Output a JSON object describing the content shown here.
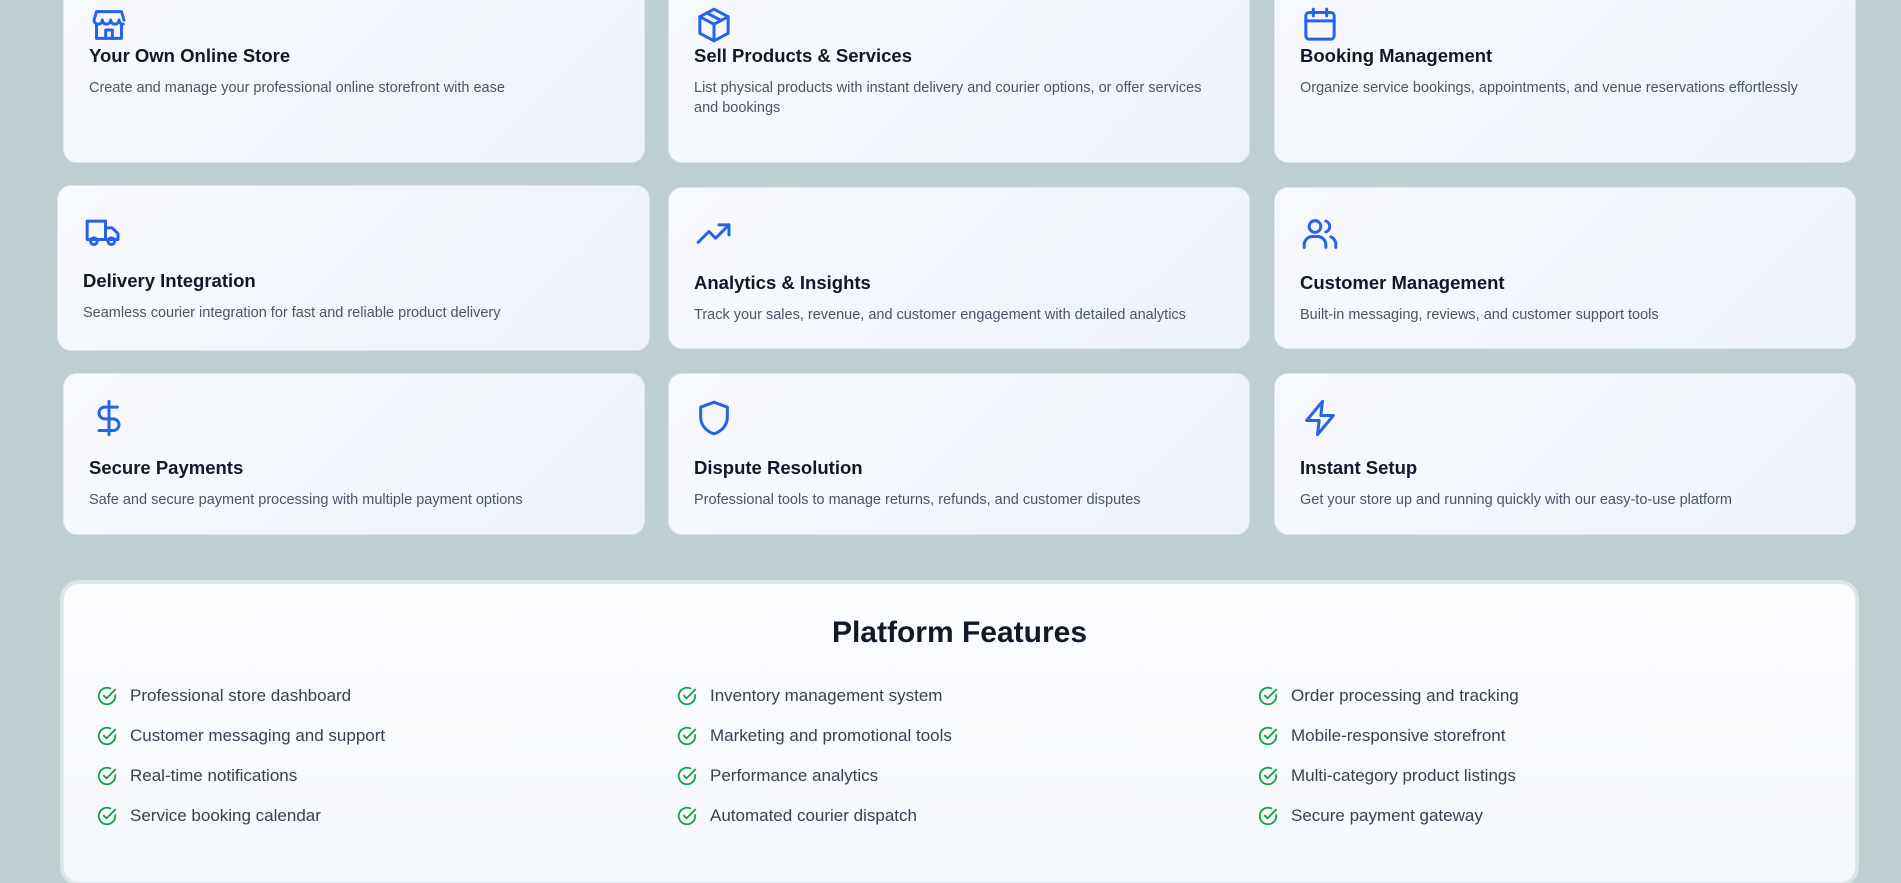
{
  "cards": [
    {
      "title": "Your Own Online Store",
      "desc": "Create and manage your professional online storefront with ease",
      "icon": "store-icon"
    },
    {
      "title": "Sell Products & Services",
      "desc": "List physical products with instant delivery and courier options, or offer services and bookings",
      "icon": "package-icon"
    },
    {
      "title": "Booking Management",
      "desc": "Organize service bookings, appointments, and venue reservations effortlessly",
      "icon": "calendar-icon"
    },
    {
      "title": "Delivery Integration",
      "desc": "Seamless courier integration for fast and reliable product delivery",
      "icon": "truck-icon"
    },
    {
      "title": "Analytics & Insights",
      "desc": "Track your sales, revenue, and customer engagement with detailed analytics",
      "icon": "trending-up-icon"
    },
    {
      "title": "Customer Management",
      "desc": "Built-in messaging, reviews, and customer support tools",
      "icon": "users-icon"
    },
    {
      "title": "Secure Payments",
      "desc": "Safe and secure payment processing with multiple payment options",
      "icon": "dollar-icon"
    },
    {
      "title": "Dispute Resolution",
      "desc": "Professional tools to manage returns, refunds, and customer disputes",
      "icon": "shield-icon"
    },
    {
      "title": "Instant Setup",
      "desc": "Get your store up and running quickly with our easy-to-use platform",
      "icon": "zap-icon"
    }
  ],
  "platform_features": {
    "heading": "Platform Features",
    "columns": [
      [
        "Professional store dashboard",
        "Customer messaging and support",
        "Real-time notifications",
        "Service booking calendar"
      ],
      [
        "Inventory management system",
        "Marketing and promotional tools",
        "Performance analytics",
        "Automated courier dispatch"
      ],
      [
        "Order processing and tracking",
        "Mobile-responsive storefront",
        "Multi-category product listings",
        "Secure payment gateway"
      ]
    ]
  },
  "colors": {
    "background": "#bfcfd1",
    "accent_icon": "#2563eb",
    "check_icon": "#16a34a"
  }
}
